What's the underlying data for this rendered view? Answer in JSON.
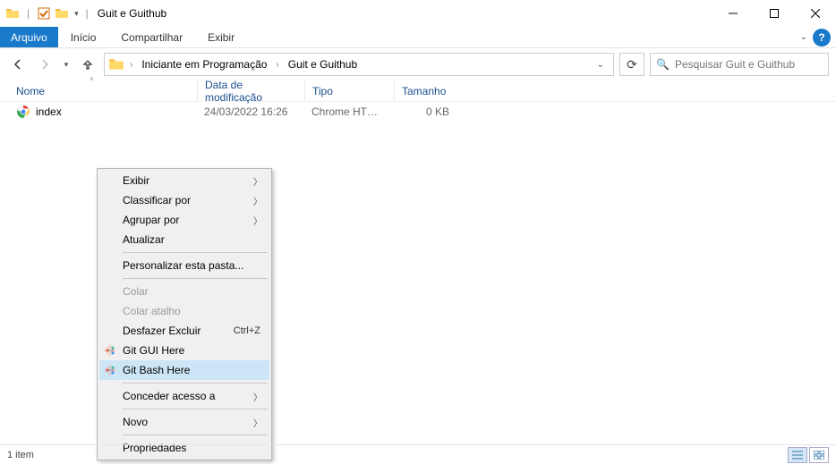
{
  "title": "Guit e Guithub",
  "ribbon": {
    "file": "Arquivo",
    "tabs": [
      "Início",
      "Compartilhar",
      "Exibir"
    ]
  },
  "breadcrumbs": [
    "Iniciante em Programação",
    "Guit e Guithub"
  ],
  "search_placeholder": "Pesquisar Guit e Guithub",
  "columns": {
    "name": "Nome",
    "modified": "Data de modificação",
    "type": "Tipo",
    "size": "Tamanho"
  },
  "files": [
    {
      "name": "index",
      "modified": "24/03/2022 16:26",
      "type": "Chrome HTML Do...",
      "size": "0 KB"
    }
  ],
  "context_menu": {
    "view": "Exibir",
    "sort": "Classificar por",
    "group": "Agrupar por",
    "refresh": "Atualizar",
    "customize": "Personalizar esta pasta...",
    "paste": "Colar",
    "paste_shortcut": "Colar atalho",
    "undo_delete": "Desfazer Excluir",
    "undo_shortcut": "Ctrl+Z",
    "git_gui": "Git GUI Here",
    "git_bash": "Git Bash Here",
    "grant_access": "Conceder acesso a",
    "new": "Novo",
    "properties": "Propriedades"
  },
  "status": {
    "items": "1 item"
  }
}
